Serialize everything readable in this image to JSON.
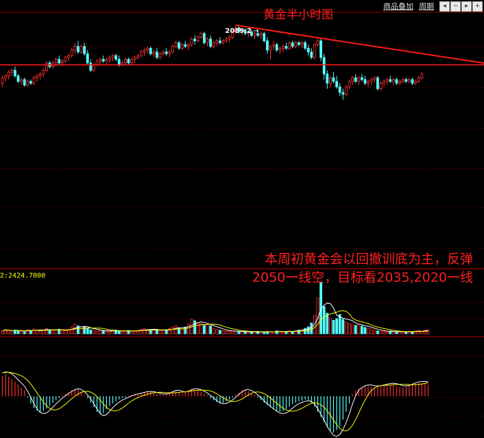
{
  "toolbar": {
    "overlay_label": "商品叠加",
    "period_label": "周期",
    "nav_icons": [
      "left-arrow-icon",
      "zoom-out-icon",
      "right-arrow-icon",
      "zoom-in-icon"
    ]
  },
  "colors": {
    "up": "#ff3232",
    "down": "#54ffff",
    "trendline": "#ff1a1a",
    "gridline": "#7a0000",
    "ma_yellow": "#ffff00",
    "ma_white": "#ffffff",
    "title": "#ff2020",
    "annotation": "#ff2020"
  },
  "chart_data": [
    {
      "type": "candlestick",
      "title": "黄金半小时图",
      "ylim": [
        2012,
        2095
      ],
      "high_label": "2089.2",
      "high_value": 2089.2,
      "annotation_lines": [
        "本周初黄金会以回撤训底为主，反弹",
        "2050一线空，目标看2035,2020一线"
      ],
      "horizontal_line": 2068,
      "trendline": [
        {
          "bar": 74,
          "value": 2089.5
        },
        {
          "bar": 162,
          "value": 2066.5
        }
      ],
      "bars": [
        [
          2058,
          2062,
          2056,
          2061
        ],
        [
          2061,
          2063,
          2059,
          2062
        ],
        [
          2062,
          2065,
          2060,
          2064
        ],
        [
          2064,
          2066,
          2062,
          2065
        ],
        [
          2065,
          2067,
          2061,
          2062
        ],
        [
          2062,
          2063,
          2058,
          2059
        ],
        [
          2059,
          2061,
          2057,
          2060
        ],
        [
          2060,
          2061,
          2056,
          2057
        ],
        [
          2057,
          2060,
          2056,
          2059
        ],
        [
          2059,
          2060,
          2057,
          2058
        ],
        [
          2058,
          2062,
          2057,
          2061
        ],
        [
          2061,
          2063,
          2059,
          2062
        ],
        [
          2062,
          2064,
          2060,
          2063
        ],
        [
          2063,
          2066,
          2061,
          2065
        ],
        [
          2065,
          2070,
          2064,
          2069
        ],
        [
          2069,
          2070,
          2066,
          2067
        ],
        [
          2067,
          2070,
          2066,
          2069
        ],
        [
          2069,
          2072,
          2067,
          2071
        ],
        [
          2071,
          2073,
          2068,
          2069
        ],
        [
          2069,
          2071,
          2067,
          2070
        ],
        [
          2070,
          2073,
          2069,
          2072
        ],
        [
          2072,
          2074,
          2070,
          2073
        ],
        [
          2073,
          2077,
          2072,
          2076
        ],
        [
          2076,
          2080,
          2074,
          2078
        ],
        [
          2078,
          2081,
          2074,
          2075
        ],
        [
          2075,
          2079,
          2074,
          2078
        ],
        [
          2078,
          2080,
          2073,
          2074
        ],
        [
          2074,
          2076,
          2068,
          2069
        ],
        [
          2069,
          2071,
          2064,
          2065
        ],
        [
          2065,
          2069,
          2064,
          2068
        ],
        [
          2068,
          2071,
          2067,
          2070
        ],
        [
          2070,
          2072,
          2068,
          2071
        ],
        [
          2071,
          2073,
          2069,
          2070
        ],
        [
          2070,
          2072,
          2068,
          2071
        ],
        [
          2071,
          2073,
          2069,
          2072
        ],
        [
          2072,
          2074,
          2070,
          2073
        ],
        [
          2073,
          2074,
          2070,
          2071
        ],
        [
          2071,
          2073,
          2067,
          2068
        ],
        [
          2068,
          2070,
          2067,
          2069
        ],
        [
          2069,
          2072,
          2068,
          2071
        ],
        [
          2071,
          2072,
          2068,
          2069
        ],
        [
          2069,
          2072,
          2068,
          2071
        ],
        [
          2071,
          2073,
          2069,
          2072
        ],
        [
          2072,
          2074,
          2071,
          2073
        ],
        [
          2073,
          2076,
          2072,
          2075
        ],
        [
          2075,
          2077,
          2073,
          2076
        ],
        [
          2076,
          2078,
          2074,
          2077
        ],
        [
          2077,
          2078,
          2073,
          2074
        ],
        [
          2074,
          2076,
          2072,
          2075
        ],
        [
          2075,
          2077,
          2071,
          2072
        ],
        [
          2072,
          2075,
          2071,
          2074
        ],
        [
          2074,
          2076,
          2073,
          2075
        ],
        [
          2075,
          2077,
          2073,
          2074
        ],
        [
          2074,
          2076,
          2072,
          2075
        ],
        [
          2075,
          2079,
          2074,
          2078
        ],
        [
          2078,
          2081,
          2077,
          2080
        ],
        [
          2080,
          2081,
          2076,
          2077
        ],
        [
          2077,
          2080,
          2076,
          2079
        ],
        [
          2079,
          2081,
          2077,
          2078
        ],
        [
          2078,
          2080,
          2076,
          2079
        ],
        [
          2079,
          2083,
          2078,
          2082
        ],
        [
          2082,
          2084,
          2079,
          2081
        ],
        [
          2081,
          2084,
          2080,
          2083
        ],
        [
          2083,
          2086,
          2082,
          2085
        ],
        [
          2085,
          2086,
          2079,
          2080
        ],
        [
          2080,
          2083,
          2078,
          2082
        ],
        [
          2082,
          2084,
          2077,
          2078
        ],
        [
          2078,
          2081,
          2077,
          2080
        ],
        [
          2080,
          2082,
          2078,
          2081
        ],
        [
          2081,
          2083,
          2079,
          2080
        ],
        [
          2080,
          2082,
          2079,
          2081
        ],
        [
          2081,
          2083,
          2080,
          2082
        ],
        [
          2082,
          2084,
          2080,
          2083
        ],
        [
          2083,
          2087,
          2082,
          2086
        ],
        [
          2086,
          2089.2,
          2085,
          2088
        ],
        [
          2088,
          2089,
          2085,
          2086
        ],
        [
          2086,
          2088,
          2084,
          2087
        ],
        [
          2087,
          2088,
          2084,
          2085
        ],
        [
          2085,
          2087,
          2083,
          2086
        ],
        [
          2086,
          2087,
          2083,
          2084
        ],
        [
          2084,
          2086,
          2082,
          2085
        ],
        [
          2085,
          2087,
          2083,
          2084
        ],
        [
          2084,
          2086,
          2082,
          2085
        ],
        [
          2085,
          2086,
          2080,
          2081
        ],
        [
          2081,
          2083,
          2074,
          2076
        ],
        [
          2076,
          2079,
          2071,
          2078
        ],
        [
          2078,
          2081,
          2076,
          2079
        ],
        [
          2079,
          2080,
          2075,
          2076
        ],
        [
          2076,
          2078,
          2074,
          2077
        ],
        [
          2077,
          2079,
          2075,
          2078
        ],
        [
          2078,
          2080,
          2076,
          2077
        ],
        [
          2077,
          2081,
          2076,
          2080
        ],
        [
          2080,
          2081,
          2077,
          2078
        ],
        [
          2078,
          2081,
          2077,
          2080
        ],
        [
          2080,
          2081,
          2078,
          2079
        ],
        [
          2079,
          2081,
          2077,
          2080
        ],
        [
          2080,
          2081,
          2076,
          2077
        ],
        [
          2077,
          2079,
          2073,
          2075
        ],
        [
          2075,
          2077,
          2071,
          2072
        ],
        [
          2072,
          2080,
          2071,
          2079
        ],
        [
          2079,
          2082,
          2078,
          2081
        ],
        [
          2081,
          2082,
          2070,
          2072
        ],
        [
          2072,
          2074,
          2060,
          2063
        ],
        [
          2063,
          2065,
          2055,
          2058
        ],
        [
          2058,
          2062,
          2056,
          2061
        ],
        [
          2061,
          2064,
          2058,
          2059
        ],
        [
          2059,
          2062,
          2055,
          2056
        ],
        [
          2056,
          2058,
          2051,
          2053
        ],
        [
          2053,
          2055,
          2049,
          2052
        ],
        [
          2052,
          2057,
          2051,
          2056
        ],
        [
          2056,
          2060,
          2055,
          2059
        ],
        [
          2059,
          2062,
          2057,
          2061
        ],
        [
          2061,
          2063,
          2058,
          2059
        ],
        [
          2059,
          2062,
          2057,
          2061
        ],
        [
          2061,
          2063,
          2059,
          2060
        ],
        [
          2060,
          2062,
          2057,
          2058
        ],
        [
          2058,
          2060,
          2056,
          2059
        ],
        [
          2059,
          2061,
          2057,
          2060
        ],
        [
          2060,
          2062,
          2058,
          2061
        ],
        [
          2061,
          2062,
          2054,
          2055
        ],
        [
          2055,
          2059,
          2054,
          2058
        ],
        [
          2058,
          2060,
          2056,
          2059
        ],
        [
          2059,
          2061,
          2057,
          2060
        ],
        [
          2060,
          2062,
          2058,
          2059
        ],
        [
          2059,
          2061,
          2057,
          2060
        ],
        [
          2060,
          2061,
          2057,
          2058
        ],
        [
          2058,
          2060,
          2057,
          2059
        ],
        [
          2059,
          2061,
          2058,
          2060
        ],
        [
          2060,
          2061,
          2058,
          2059
        ],
        [
          2059,
          2061,
          2058,
          2060
        ],
        [
          2060,
          2061,
          2057,
          2058
        ],
        [
          2058,
          2060,
          2057,
          2059
        ],
        [
          2059,
          2062,
          2058,
          2061
        ],
        [
          2061,
          2064,
          2060,
          2063
        ]
      ]
    },
    {
      "type": "bar",
      "title": "",
      "legend_text": "2:2424.7000",
      "ylim": [
        0,
        2600
      ],
      "values": [
        140,
        210,
        170,
        120,
        180,
        150,
        110,
        90,
        200,
        160,
        230,
        180,
        140,
        190,
        250,
        200,
        160,
        180,
        220,
        170,
        150,
        210,
        330,
        450,
        380,
        270,
        340,
        260,
        190,
        160,
        130,
        170,
        150,
        120,
        100,
        140,
        180,
        150,
        110,
        130,
        160,
        120,
        140,
        170,
        210,
        260,
        200,
        180,
        220,
        190,
        160,
        140,
        200,
        260,
        320,
        380,
        280,
        230,
        320,
        460,
        690,
        620,
        540,
        480,
        400,
        430,
        380,
        260,
        210,
        170,
        150,
        130,
        110,
        140,
        120,
        100,
        90,
        110,
        80,
        70,
        90,
        120,
        100,
        80,
        110,
        90,
        100,
        140,
        120,
        110,
        100,
        130,
        110,
        160,
        180,
        220,
        260,
        330,
        520,
        870,
        1700,
        2424.7,
        1300,
        980,
        750,
        640,
        720,
        920,
        690,
        560,
        480,
        430,
        400,
        450,
        360,
        300,
        260,
        230,
        170,
        140,
        120,
        110,
        100,
        130,
        90,
        80,
        110,
        90,
        100,
        120,
        90,
        140,
        160,
        110,
        170,
        190
      ]
    },
    {
      "type": "bar",
      "title": "",
      "ylim": [
        -6,
        7
      ],
      "values": [
        3.1,
        3.4,
        3.0,
        2.6,
        2.2,
        1.8,
        1.3,
        0.9,
        -0.2,
        -1.1,
        -1.8,
        -2.2,
        -2.5,
        -2.3,
        -1.9,
        -1.5,
        -1.0,
        -0.6,
        -0.3,
        0.1,
        0.4,
        0.6,
        0.9,
        1.1,
        1.0,
        0.6,
        0.2,
        -0.3,
        -1.0,
        -1.7,
        -2.4,
        -2.8,
        -2.6,
        -2.0,
        -1.5,
        -1.1,
        -0.8,
        -0.5,
        -0.3,
        -0.2,
        0.1,
        0.2,
        0.3,
        0.4,
        0.5,
        0.6,
        0.7,
        0.6,
        0.5,
        0.4,
        0.3,
        0.2,
        0.4,
        0.6,
        0.8,
        0.9,
        0.7,
        0.4,
        0.6,
        0.9,
        1.1,
        1.0,
        0.9,
        0.7,
        0.4,
        0.2,
        -0.3,
        -0.6,
        -0.9,
        -1.1,
        -1.0,
        -0.8,
        -0.5,
        -0.2,
        0.3,
        0.6,
        0.9,
        1.0,
        0.8,
        0.5,
        0.2,
        -0.2,
        -0.6,
        -1.0,
        -1.4,
        -1.7,
        -2.0,
        -2.3,
        -2.4,
        -2.3,
        -2.0,
        -1.6,
        -1.2,
        -1.0,
        -0.8,
        -0.7,
        -0.5,
        -0.6,
        -1.0,
        -1.6,
        -2.4,
        -3.2,
        -4.0,
        -4.8,
        -5.3,
        -5.6,
        -5.2,
        -4.6,
        -3.6,
        -2.4,
        -1.1,
        0.3,
        0.9,
        1.2,
        1.4,
        1.6,
        1.5,
        1.4,
        1.3,
        1.4,
        1.5,
        1.6,
        1.7,
        1.8,
        1.7,
        1.5,
        1.4,
        1.3,
        1.4,
        1.6,
        1.8,
        1.9,
        2.0,
        2.0,
        1.9,
        1.8
      ]
    }
  ]
}
